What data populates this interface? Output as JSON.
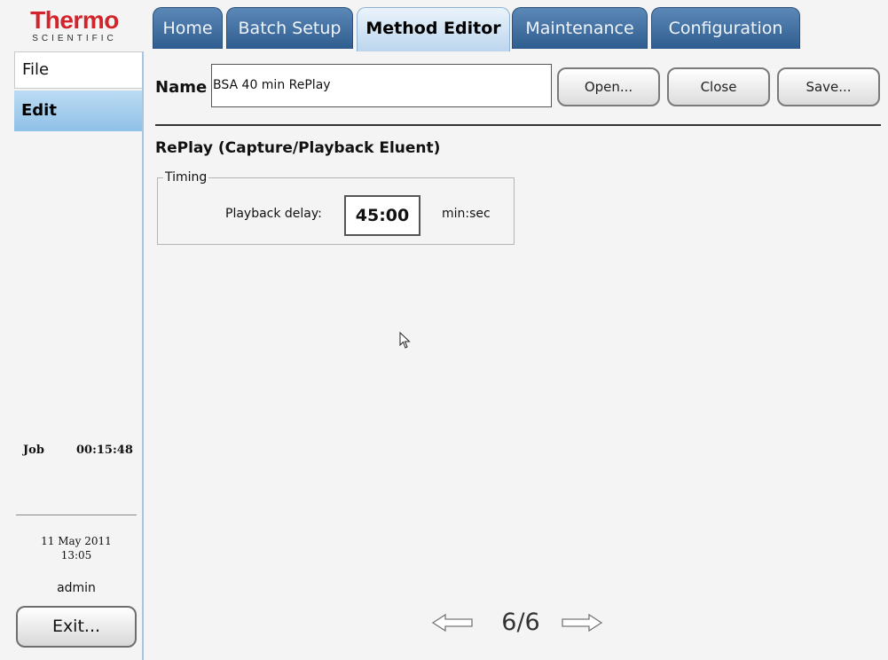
{
  "brand": {
    "logo_main": "Thermo",
    "logo_sub": "SCIENTIFIC",
    "accent": "#d3232b"
  },
  "tabs": [
    {
      "label": "Home",
      "active": false
    },
    {
      "label": "Batch Setup",
      "active": false
    },
    {
      "label": "Method Editor",
      "active": true
    },
    {
      "label": "Maintenance",
      "active": false
    },
    {
      "label": "Configuration",
      "active": false
    }
  ],
  "left_menu": [
    {
      "label": "File",
      "selected": false
    },
    {
      "label": "Edit",
      "selected": true
    }
  ],
  "status": {
    "job_label": "Job",
    "job_time": "00:15:48",
    "date": "11 May 2011",
    "time": "13:05",
    "user": "admin",
    "exit_label": "Exit..."
  },
  "method": {
    "name_label": "Name",
    "name_value": "BSA 40 min RePlay",
    "open_label": "Open...",
    "close_label": "Close",
    "save_label": "Save..."
  },
  "section": {
    "title": "RePlay (Capture/Playback Eluent)",
    "group_legend": "Timing",
    "playback_label": "Playback delay:",
    "playback_value": "45:00",
    "playback_unit": "min:sec"
  },
  "pager": {
    "text": "6/6",
    "prev_icon": "arrow-left-icon",
    "next_icon": "arrow-right-icon"
  },
  "colors": {
    "tab_active": "#bcd6ee",
    "tab_inactive": "#2f5d8f",
    "nav_selected": "#8fc0e6"
  }
}
